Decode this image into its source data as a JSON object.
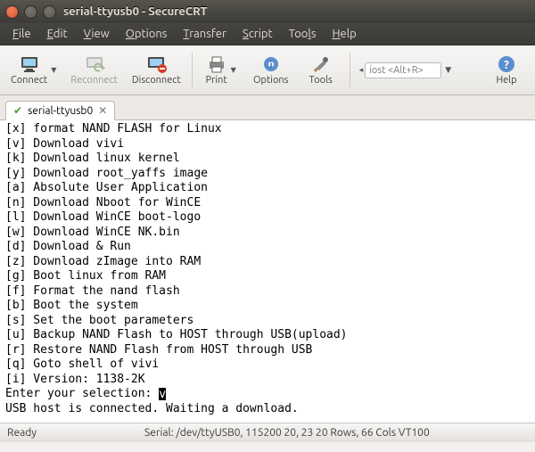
{
  "window": {
    "title": "serial-ttyusb0 - SecureCRT"
  },
  "menu": {
    "file": {
      "label": "File",
      "ak": "F",
      "rest": "ile"
    },
    "edit": {
      "label": "Edit",
      "ak": "E",
      "rest": "dit"
    },
    "view": {
      "label": "View",
      "ak": "V",
      "rest": "iew"
    },
    "options": {
      "label": "Options",
      "ak": "O",
      "rest": "ptions"
    },
    "transfer": {
      "label": "Transfer",
      "ak": "T",
      "rest": "ransfer"
    },
    "script": {
      "label": "Script",
      "ak": "S",
      "rest": "cript"
    },
    "tools": {
      "label": "Tools",
      "pre": "Too",
      "ak": "l",
      "rest": "s"
    },
    "help": {
      "label": "Help",
      "ak": "H",
      "rest": "elp"
    }
  },
  "toolbar": {
    "connect": "Connect",
    "reconnect": "Reconnect",
    "disconnect": "Disconnect",
    "print": "Print",
    "options": "Options",
    "tools": "Tools",
    "help": "Help",
    "host_placeholder": "iost <Alt+R>"
  },
  "tab": {
    "label": "serial-ttyusb0"
  },
  "terminal": {
    "lines": [
      "[x] format NAND FLASH for Linux",
      "[v] Download vivi",
      "[k] Download linux kernel",
      "[y] Download root_yaffs image",
      "[a] Absolute User Application",
      "[n] Download Nboot for WinCE",
      "[l] Download WinCE boot-logo",
      "[w] Download WinCE NK.bin",
      "[d] Download & Run",
      "[z] Download zImage into RAM",
      "[g] Boot linux from RAM",
      "[f] Format the nand flash",
      "[b] Boot the system",
      "[s] Set the boot parameters",
      "[u] Backup NAND Flash to HOST through USB(upload)",
      "[r] Restore NAND Flash from HOST through USB",
      "[q] Goto shell of vivi",
      "[i] Version: 1138-2K"
    ],
    "prompt": "Enter your selection: ",
    "cursor_char": "v",
    "tail": "USB host is connected. Waiting a download."
  },
  "status": {
    "ready": "Ready",
    "info": "Serial: /dev/ttyUSB0, 115200  20, 23  20 Rows, 66 Cols  VT100"
  }
}
